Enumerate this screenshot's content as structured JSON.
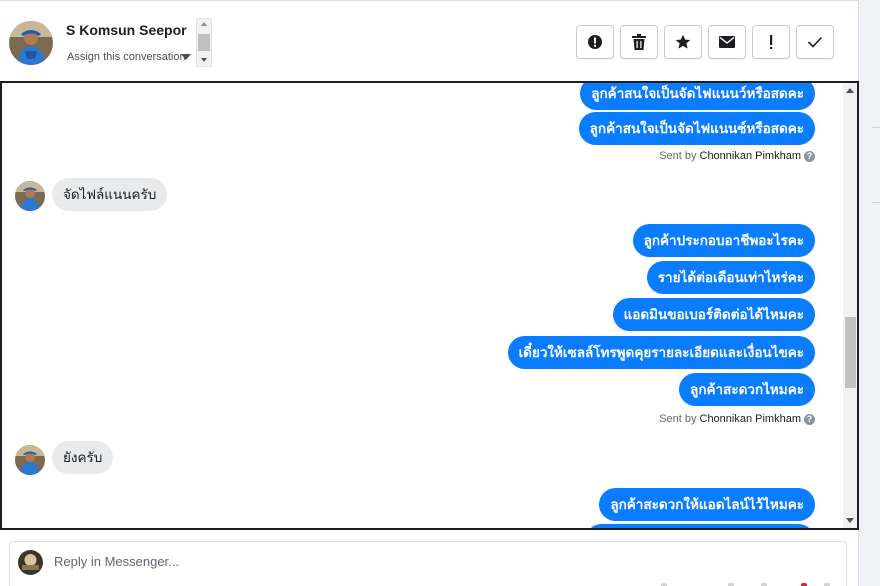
{
  "header": {
    "user_name": "S Komsun Seepor",
    "assign_label": "Assign this conversation",
    "actions": [
      {
        "icon": "alert-circle-icon",
        "name": "mark-spam-button"
      },
      {
        "icon": "trash-icon",
        "name": "delete-button"
      },
      {
        "icon": "star-icon",
        "name": "star-button"
      },
      {
        "icon": "envelope-icon",
        "name": "mark-unread-button"
      },
      {
        "icon": "exclamation-icon",
        "name": "follow-up-button"
      },
      {
        "icon": "checkmark-icon",
        "name": "mark-done-button"
      }
    ]
  },
  "conversation": {
    "outgoing_1": [
      "ลูกค้าสนใจเป็นจัดไฟแนนว์หรือสดคะ",
      "ลูกค้าสนใจเป็นจัดไฟแนนซ์หรือสดคะ"
    ],
    "sent_by_label": "Sent by",
    "sent_by_name": "Chonnikan Pimkham",
    "incoming_1": "จัดไฟล์แนนครับ",
    "outgoing_2": [
      "ลูกค้าประกอบอาชีพอะไรคะ",
      "รายได้ต่อเดือนเท่าไหร่คะ",
      "แอดมินขอเบอร์ติดต่อได้ไหมคะ",
      "เดี๋ยวให้เซลล์โทรพูดคุยรายละเอียดและเงื่อนไขคะ",
      "ลูกค้าสะดวกไหมคะ"
    ],
    "incoming_2": "ยังครับ",
    "outgoing_3": [
      "ลูกค้าสะดวกให้แอดไลน์ไว้ไหมคะ"
    ]
  },
  "reply": {
    "placeholder": "Reply in Messenger..."
  },
  "colors": {
    "outgoing_bubble": "#0a7cff",
    "incoming_bubble": "#e9eaeb"
  }
}
